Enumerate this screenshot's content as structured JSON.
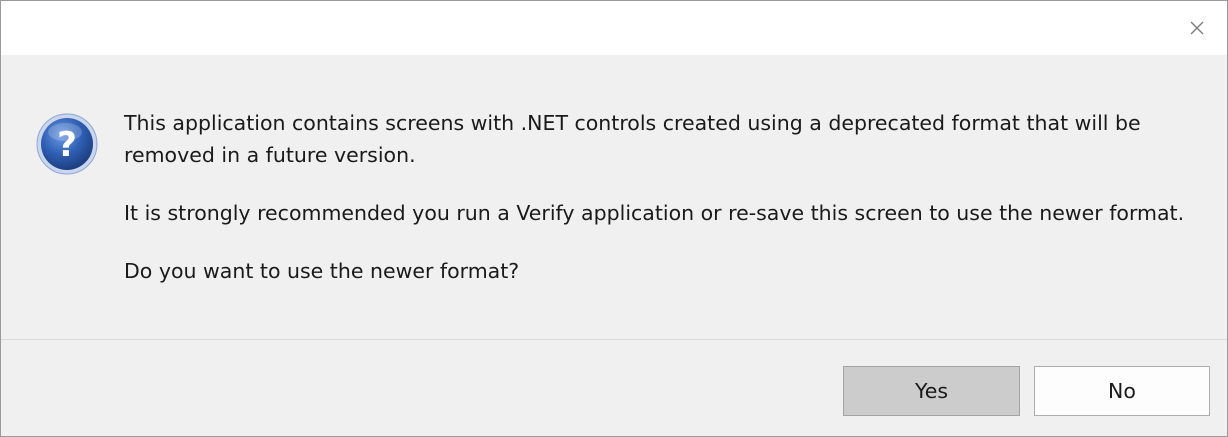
{
  "dialog": {
    "close_icon": "close-icon",
    "message_icon": "question-icon",
    "message_lines": [
      "This application contains screens with .NET controls created using a deprecated format that will be",
      "removed in a future version.",
      "It is strongly recommended you run a Verify application or re-save this screen to use the newer format.",
      "Do you want to use the newer format?"
    ],
    "icon_glyph": "?",
    "buttons": {
      "yes_label": "Yes",
      "no_label": "No"
    }
  },
  "colors": {
    "question_icon_fill": "#2f5fb3",
    "question_icon_ring": "#c9d6ee",
    "default_button_bg": "#cccccc",
    "dialog_bg": "#f0f0f0"
  }
}
